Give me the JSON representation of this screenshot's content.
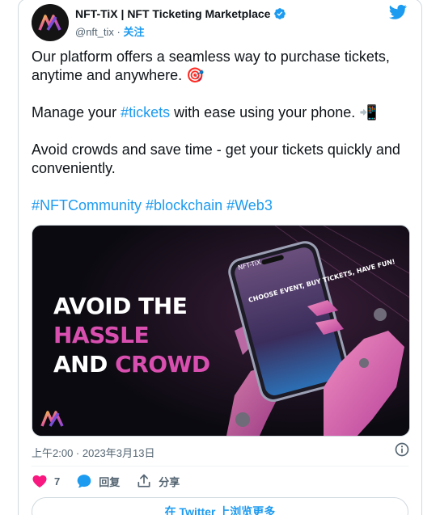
{
  "account": {
    "name": "NFT-TiX | NFT Ticketing Marketplace",
    "handle": "@nft_tix",
    "separator": "·",
    "follow_label": "关注"
  },
  "tweet": {
    "line1": "Our platform offers a seamless way to purchase tickets, anytime and anywhere.",
    "line1_emoji": "🎯",
    "line2_prefix": "Manage your ",
    "line2_tag": "#tickets",
    "line2_suffix": " with ease using your phone.",
    "line2_emoji": "📲",
    "line3": "Avoid crowds and save time - get your tickets quickly and conveniently.",
    "hashtags": [
      "#NFTCommunity",
      "#blockchain",
      "#Web3"
    ]
  },
  "media": {
    "headline_line1": "AVOID THE",
    "headline_line2": "HASSLE",
    "headline_line3_a": "AND ",
    "headline_line3_b": "CROWD",
    "phone_app_name": "NFT-TiX",
    "phone_text": "CHOOSE EVENT, BUY TICKETS, HAVE FUN!"
  },
  "timestamp": "上午2:00 · 2023年3月13日",
  "actions": {
    "likes": "7",
    "reply_label": "回复",
    "share_label": "分享"
  },
  "view_more_label": "在 Twitter 上浏览更多",
  "colors": {
    "accent": "#1d9bf0",
    "like": "#f91880",
    "headline_pink": "#d84fb0"
  }
}
